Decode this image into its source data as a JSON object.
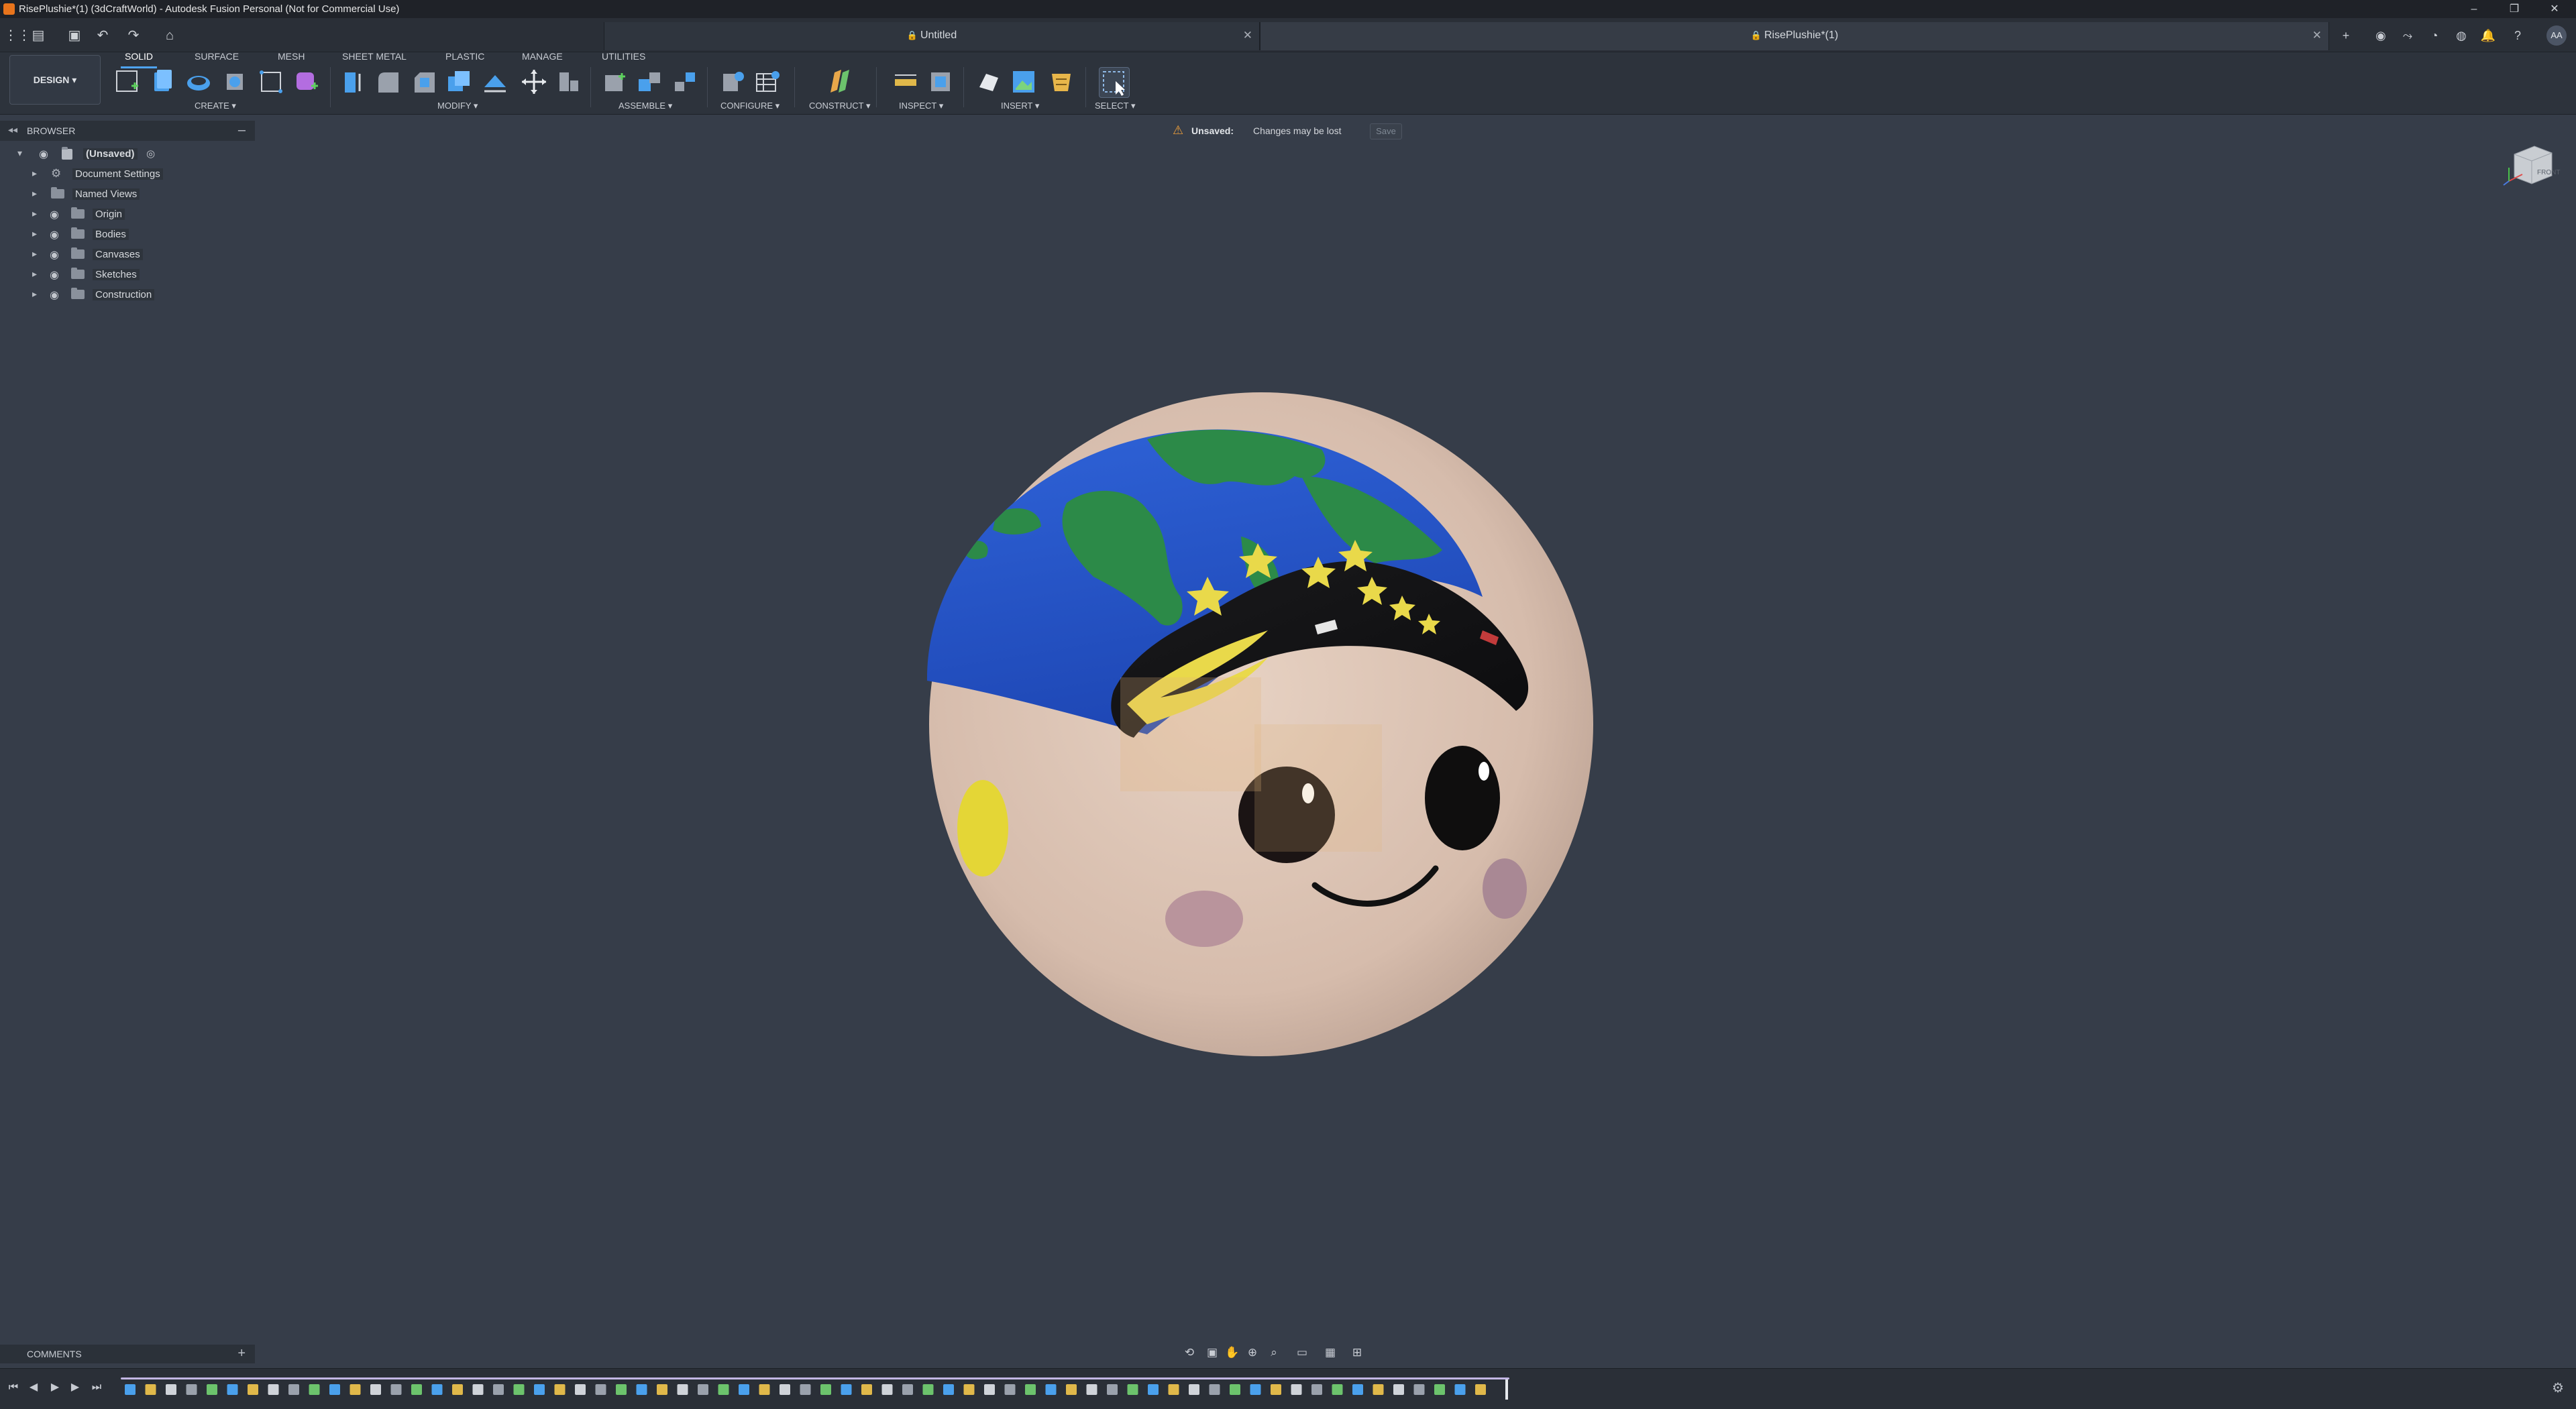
{
  "window": {
    "title": "RisePlushie*(1) (3dCraftWorld) - Autodesk Fusion Personal (Not for Commercial Use)",
    "controls": [
      "–",
      "❐",
      "✕"
    ]
  },
  "tabs": [
    {
      "label": "Untitled",
      "active": false
    },
    {
      "label": "RisePlushie*(1)",
      "active": true
    }
  ],
  "toolbar": {
    "workspace_button": "DESIGN ▾",
    "workspace_tabs": [
      "SOLID",
      "SURFACE",
      "MESH",
      "SHEET METAL",
      "PLASTIC",
      "MANAGE",
      "UTILITIES"
    ],
    "active_tab": "SOLID",
    "groups": [
      "CREATE ▾",
      "MODIFY ▾",
      "ASSEMBLE ▾",
      "CONFIGURE ▾",
      "CONSTRUCT ▾",
      "INSPECT ▾",
      "INSERT ▾",
      "SELECT ▾"
    ]
  },
  "browser": {
    "title": "BROWSER",
    "root": "(Unsaved)",
    "items": [
      "Document Settings",
      "Named Views",
      "Origin",
      "Bodies",
      "Canvases",
      "Sketches",
      "Construction"
    ]
  },
  "banner": {
    "label": "Unsaved:",
    "message": "Changes may be lost",
    "button": "Save"
  },
  "viewcube": {
    "face": "FRONT"
  },
  "comments": {
    "title": "COMMENTS"
  },
  "user": {
    "initials": "AA"
  },
  "colors": {
    "canvas": "#363d49",
    "accent": "#4ea3f1",
    "warning": "#f0a03a",
    "timeline_rail": "#c3b7e4"
  }
}
